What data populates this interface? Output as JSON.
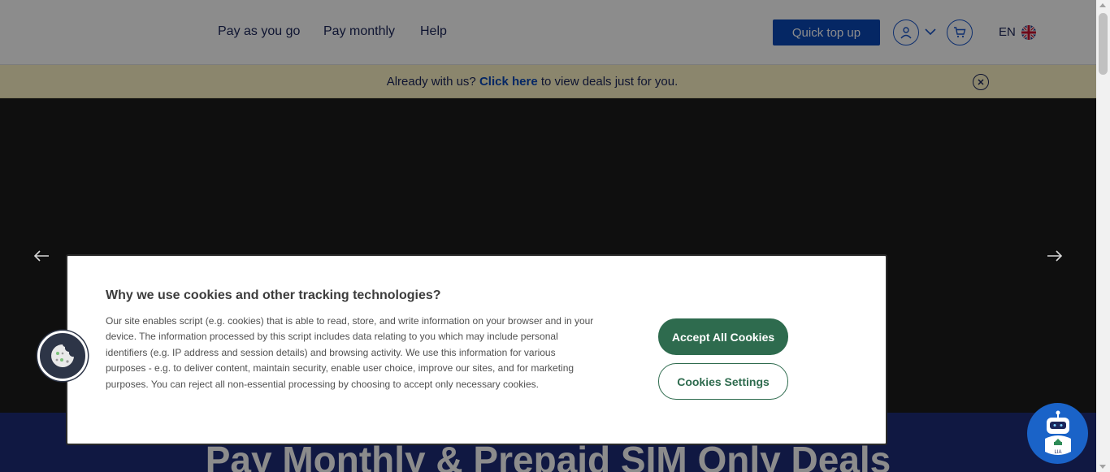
{
  "header": {
    "nav": [
      "Pay as you go",
      "Pay monthly",
      "Help"
    ],
    "quick_top_up": "Quick top up",
    "language": "EN"
  },
  "banner": {
    "prefix": "Already with us?",
    "link": "Click here",
    "suffix": "to view deals just for you."
  },
  "hero": {
    "headline": "Pay Monthly & Prepaid SIM Only Deals"
  },
  "cookie_dialog": {
    "title": "Why we use cookies and other tracking technologies?",
    "body": "Our site enables script (e.g. cookies) that is able to read, store, and write information on your browser and in your device. The information processed by this script includes data relating to you which may include personal identifiers (e.g. IP address and session details) and browsing activity. We use this information for various purposes - e.g. to deliver content, maintain security, enable user choice, improve our sites, and for marketing purposes. You can reject all non-essential processing by choosing to accept only necessary cookies.",
    "accept_label": "Accept All Cookies",
    "settings_label": "Cookies Settings"
  },
  "chat_bot": {
    "label": "LIA"
  },
  "colors": {
    "brand_blue": "#0a47b6",
    "banner_bg": "#fdf5c7",
    "cookie_green": "#2e6b4e",
    "hero_lower": "#1e2d78"
  }
}
